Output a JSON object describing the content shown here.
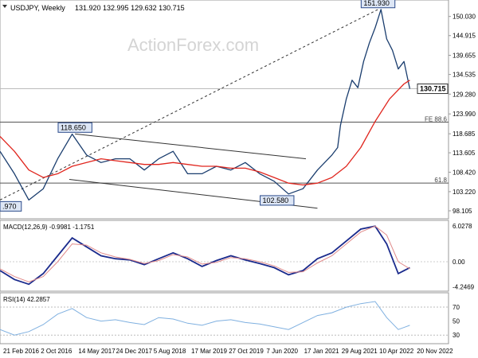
{
  "header": {
    "symbol": "USDJPY, Weekly",
    "ohlc": "131.920 132.995 129.632 130.715"
  },
  "watermark": "ActionForex.com",
  "colors": {
    "price": "#1a3d6e",
    "ma": "#e0261e",
    "macd": "#1a2a8c",
    "signal": "#e08a8a",
    "rsi": "#7fb0e0",
    "channel": "#333333",
    "hline": "#555555",
    "badge_bg": "#dde6f5",
    "badge_border": "#2b4a8a",
    "last_bg": "#ffffff"
  },
  "chart_data": [
    {
      "type": "line",
      "panel": "price",
      "ylim": [
        96.4,
        154.0
      ],
      "y_ticks": [
        "150.030",
        "144.915",
        "139.655",
        "134.535",
        "129.280",
        "123.990",
        "118.685",
        "113.605",
        "108.420",
        "103.220",
        "98.105"
      ],
      "x_ticks": [
        "21 Feb 2016",
        "2 Oct 2016",
        "14 May 2017",
        "24 Dec 2017",
        "5 Aug 2018",
        "17 Mar 2019",
        "27 Oct 2019",
        "7 Jun 2020",
        "17 Jan 2021",
        "29 Aug 2021",
        "10 Apr 2022",
        "20 Nov 2022"
      ],
      "series": [
        {
          "role": "price",
          "x": [
            0.0,
            0.5,
            1.0,
            1.5,
            2.0,
            2.5,
            3.0,
            3.5,
            4.0,
            4.5,
            5.0,
            5.5,
            6.0,
            6.5,
            7.0,
            7.5,
            8.0,
            8.5,
            9.0,
            9.5,
            10.0,
            10.5,
            11.0,
            11.5,
            11.7,
            11.8,
            12.0,
            12.2,
            12.4,
            12.6,
            12.8,
            13.0,
            13.2,
            13.4,
            13.6,
            13.8,
            14.0,
            14.2
          ],
          "y": [
            114,
            108,
            101,
            104,
            112,
            118.6,
            113,
            111,
            112,
            112,
            109,
            112,
            114,
            108,
            108,
            110,
            109,
            111,
            108,
            106,
            102.6,
            104,
            109,
            113,
            115,
            121,
            128,
            133,
            131,
            138,
            143,
            147,
            151.9,
            144,
            141,
            136,
            138,
            130.7
          ]
        },
        {
          "role": "moving-average",
          "x": [
            0.0,
            0.5,
            1.0,
            1.5,
            2.0,
            2.5,
            3.0,
            3.5,
            4.0,
            4.5,
            5.0,
            5.5,
            6.0,
            6.5,
            7.0,
            7.5,
            8.0,
            8.5,
            9.0,
            9.5,
            10.0,
            10.5,
            11.0,
            11.5,
            12.0,
            12.5,
            13.0,
            13.5,
            14.0,
            14.2
          ],
          "y": [
            118,
            114,
            109,
            107,
            108,
            110,
            111,
            112,
            111.5,
            111,
            110.5,
            110.5,
            111,
            110.5,
            110,
            110,
            109.5,
            109.5,
            108.5,
            107,
            105.5,
            105,
            105.5,
            107,
            110,
            115,
            122,
            128,
            132,
            133
          ]
        }
      ],
      "labels": [
        {
          "text": "118.650",
          "x": 2.6,
          "y": 118.65
        },
        {
          "text": "102.580",
          "x": 9.6,
          "y": 102.58
        },
        {
          "text": "151.930",
          "x": 13.1,
          "y": 151.93
        },
        {
          "text": ".970",
          "x": 0.0,
          "y": 101.0
        },
        {
          "text": "130.715",
          "x": 14.2,
          "y": 130.715
        },
        {
          "text": "FE 88.6",
          "x": 14.0,
          "y": 121.8
        },
        {
          "text": "61.8",
          "x": 14.0,
          "y": 105.5
        }
      ],
      "hlines": [
        130.715,
        121.8,
        105.5
      ]
    },
    {
      "type": "line",
      "panel": "macd",
      "title": "MACD(12,26,9) -0.9981 -1.1751",
      "ylim": [
        -4.7,
        6.3
      ],
      "y_ticks": [
        "6.0278",
        "0.00",
        "-4.2469"
      ],
      "series": [
        {
          "role": "macd",
          "x": [
            0.0,
            0.5,
            1.0,
            1.5,
            2.0,
            2.5,
            3.0,
            3.5,
            4.0,
            4.5,
            5.0,
            5.5,
            6.0,
            6.5,
            7.0,
            7.5,
            8.0,
            8.5,
            9.0,
            9.5,
            10.0,
            10.5,
            11.0,
            11.5,
            12.0,
            12.5,
            13.0,
            13.4,
            13.8,
            14.2
          ],
          "y": [
            -1.5,
            -3.0,
            -3.8,
            -2.0,
            1.0,
            4.0,
            2.5,
            1.0,
            0.5,
            0.3,
            -0.5,
            0.5,
            1.5,
            0.5,
            -0.8,
            0.2,
            1.0,
            0.3,
            -0.3,
            -1.0,
            -2.2,
            -1.5,
            0.5,
            1.5,
            3.5,
            5.5,
            6.0,
            3.0,
            -2.0,
            -1.0
          ]
        },
        {
          "role": "signal",
          "x": [
            0.0,
            0.5,
            1.0,
            1.5,
            2.0,
            2.5,
            3.0,
            3.5,
            4.0,
            4.5,
            5.0,
            5.5,
            6.0,
            6.5,
            7.0,
            7.5,
            8.0,
            8.5,
            9.0,
            9.5,
            10.0,
            10.5,
            11.0,
            11.5,
            12.0,
            12.5,
            13.0,
            13.4,
            13.8,
            14.2
          ],
          "y": [
            -1.2,
            -2.5,
            -3.4,
            -2.5,
            0.0,
            3.0,
            2.8,
            1.5,
            0.8,
            0.4,
            -0.3,
            0.2,
            1.2,
            0.8,
            -0.4,
            -0.1,
            0.7,
            0.5,
            0.0,
            -0.7,
            -1.8,
            -1.7,
            -0.2,
            1.0,
            3.0,
            5.0,
            6.0,
            4.5,
            0.0,
            -1.2
          ]
        }
      ]
    },
    {
      "type": "line",
      "panel": "rsi",
      "title": "RSI(14) 42.2857",
      "ylim": [
        20,
        86
      ],
      "y_ticks": [
        "70",
        "50",
        "30"
      ],
      "series": [
        {
          "role": "rsi",
          "x": [
            0.0,
            0.5,
            1.0,
            1.5,
            2.0,
            2.5,
            3.0,
            3.5,
            4.0,
            4.5,
            5.0,
            5.5,
            6.0,
            6.5,
            7.0,
            7.5,
            8.0,
            8.5,
            9.0,
            9.5,
            10.0,
            10.5,
            11.0,
            11.5,
            12.0,
            12.5,
            13.0,
            13.4,
            13.8,
            14.2
          ],
          "y": [
            38,
            30,
            35,
            45,
            60,
            68,
            55,
            50,
            52,
            48,
            45,
            55,
            53,
            47,
            44,
            50,
            52,
            48,
            46,
            42,
            38,
            48,
            58,
            62,
            70,
            75,
            78,
            55,
            38,
            44
          ]
        }
      ]
    }
  ]
}
